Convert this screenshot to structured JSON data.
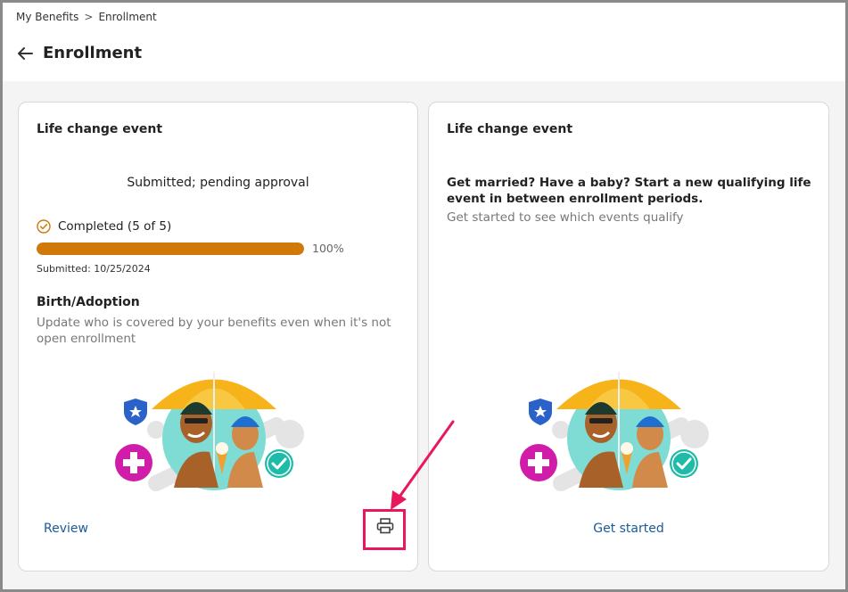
{
  "breadcrumb": {
    "root": "My Benefits",
    "separator": ">",
    "current": "Enrollment"
  },
  "page": {
    "title": "Enrollment"
  },
  "left_card": {
    "heading": "Life change event",
    "status": "Submitted; pending approval",
    "completed_label": "Completed (5 of 5)",
    "progress_percent_label": "100%",
    "progress_fraction": 1.0,
    "submitted_date": "Submitted: 10/25/2024",
    "event_title": "Birth/Adoption",
    "event_description": "Update who is covered by your benefits even when it's not open enrollment",
    "review_label": "Review",
    "print_icon": "printer-icon"
  },
  "right_card": {
    "heading": "Life change event",
    "headline": "Get married? Have a baby? Start a new qualifying life event in between enrollment periods.",
    "subtext": "Get started to see which events qualify",
    "cta_label": "Get started"
  },
  "colors": {
    "accent_orange": "#d07808",
    "link_blue": "#1a5a9a",
    "highlight_pink": "#e8185a"
  }
}
